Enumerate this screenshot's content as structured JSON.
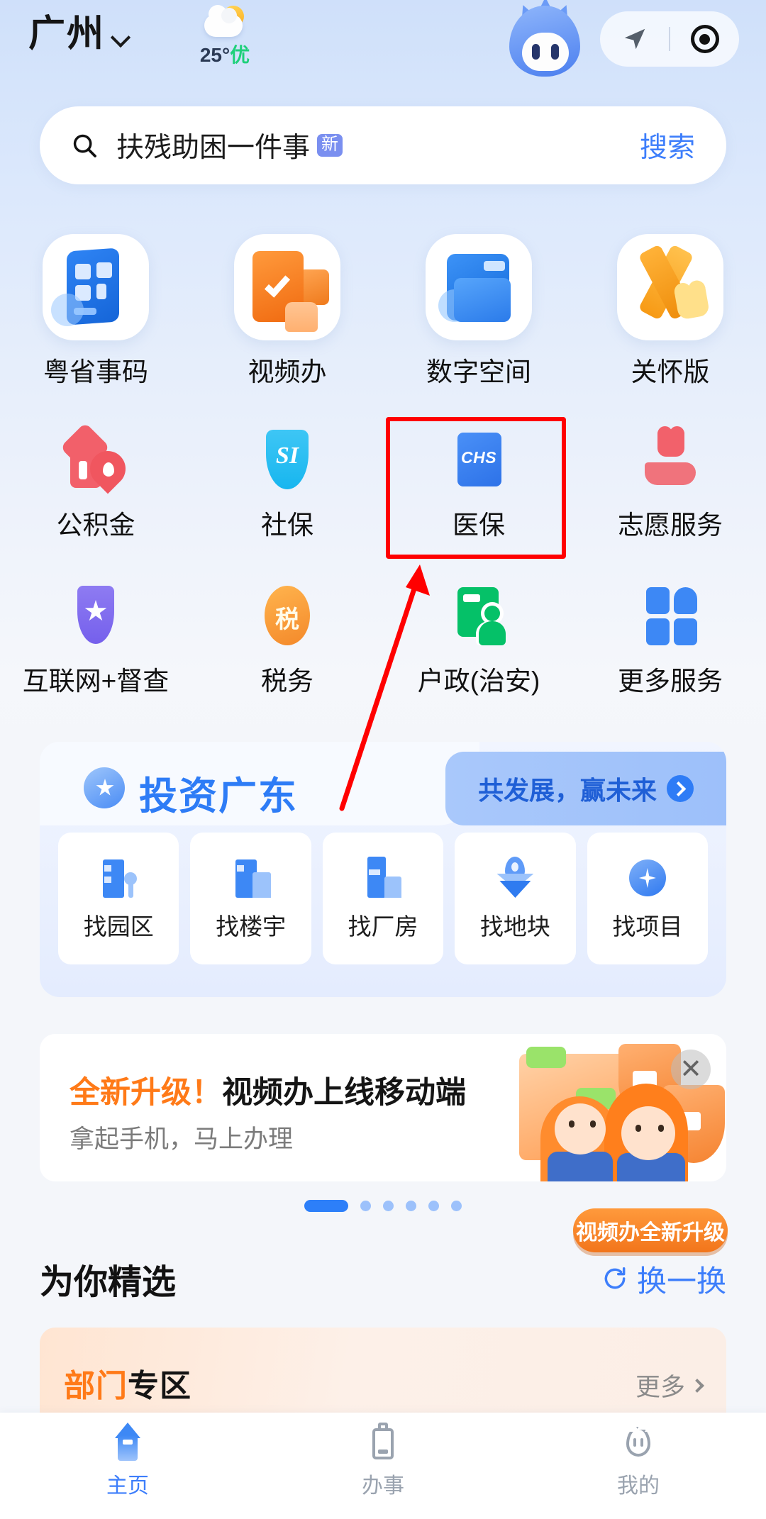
{
  "header": {
    "city": "广州",
    "city_chevron_icon": "chevron-down-icon",
    "weather_icon": "partly-cloudy-icon",
    "temperature": "25°",
    "air_quality": "优",
    "mascot_icon": "mascot-avatar-icon",
    "nav_arrow_icon": "navigation-arrow-icon",
    "scan_icon": "scan-target-icon"
  },
  "search": {
    "icon": "search-icon",
    "query": "扶残助困一件事",
    "badge": "新",
    "button_label": "搜索"
  },
  "quick_grid": {
    "row1": [
      {
        "label": "粤省事码",
        "icon": "yue-code-icon"
      },
      {
        "label": "视频办",
        "icon": "video-service-icon"
      },
      {
        "label": "数字空间",
        "icon": "digital-space-folder-icon"
      },
      {
        "label": "关怀版",
        "icon": "care-ribbon-icon"
      }
    ],
    "row2": [
      {
        "label": "公积金",
        "icon": "housing-fund-house-icon"
      },
      {
        "label": "社保",
        "icon": "social-insurance-shield-icon"
      },
      {
        "label": "医保",
        "icon": "medical-insurance-chs-icon",
        "icon_text": "CHS",
        "highlighted": true
      },
      {
        "label": "志愿服务",
        "icon": "volunteer-heart-hand-icon"
      }
    ],
    "row3": [
      {
        "label": "互联网+督查",
        "icon": "supervision-star-shield-icon"
      },
      {
        "label": "税务",
        "icon": "tax-icon",
        "icon_text": "税"
      },
      {
        "label": "户政(治安)",
        "icon": "household-id-card-icon"
      },
      {
        "label": "更多服务",
        "icon": "more-services-grid-icon"
      }
    ],
    "social_icon_text": "SI"
  },
  "invest_card": {
    "logo_icon": "invest-guangdong-logo-icon",
    "title": "投资广东",
    "slogan": "共发展，赢未来",
    "slogan_arrow_icon": "chevron-right-circle-icon",
    "tiles": [
      {
        "label": "找园区",
        "icon": "find-park-icon"
      },
      {
        "label": "找楼宇",
        "icon": "find-building-icon"
      },
      {
        "label": "找厂房",
        "icon": "find-factory-icon"
      },
      {
        "label": "找地块",
        "icon": "find-land-pin-icon"
      },
      {
        "label": "找项目",
        "icon": "find-project-spark-icon"
      }
    ]
  },
  "ad_banner": {
    "title_highlight": "全新升级！",
    "title_rest": "视频办上线移动端",
    "subtitle": "拿起手机，马上办理",
    "close_icon": "close-icon",
    "art_icon": "video-service-illustration",
    "tag_label": "视频办全新升级"
  },
  "carousel": {
    "total_dots": 6,
    "active_index": 0
  },
  "featured": {
    "title": "为你精选",
    "refresh_icon": "refresh-icon",
    "refresh_label": "换一换"
  },
  "dept_card": {
    "title_highlight": "部门",
    "title_rest": "专区",
    "more_label": "更多",
    "more_icon": "chevron-right-icon"
  },
  "tabbar": {
    "tabs": [
      {
        "label": "主页",
        "icon": "home-icon",
        "active": true
      },
      {
        "label": "办事",
        "icon": "clipboard-icon",
        "active": false
      },
      {
        "label": "我的",
        "icon": "profile-mascot-icon",
        "active": false
      }
    ]
  },
  "annotation": {
    "highlight_color": "#ff0000",
    "target_label": "医保",
    "arrow_icon": "annotation-arrow-icon"
  }
}
